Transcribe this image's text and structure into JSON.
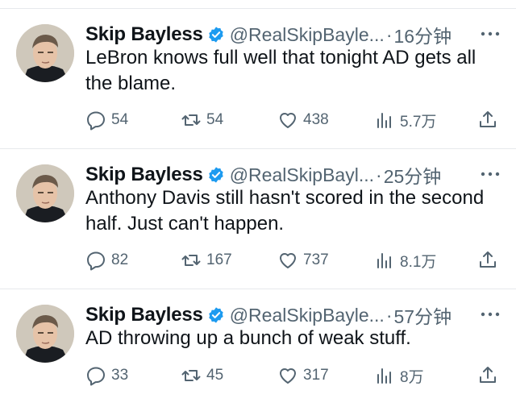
{
  "tweets": [
    {
      "name": "Skip Bayless",
      "handle": "@RealSkipBayle...",
      "dot": "·",
      "time": "16分钟",
      "text": "LeBron knows full well that tonight AD gets all the blame.",
      "replies": "54",
      "retweets": "54",
      "likes": "438",
      "views": "5.7万"
    },
    {
      "name": "Skip Bayless",
      "handle": "@RealSkipBayl...",
      "dot": "·",
      "time": "25分钟",
      "text": "Anthony Davis still hasn't scored in the second half. Just can't happen.",
      "replies": "82",
      "retweets": "167",
      "likes": "737",
      "views": "8.1万"
    },
    {
      "name": "Skip Bayless",
      "handle": "@RealSkipBayle...",
      "dot": "·",
      "time": "57分钟",
      "text": "AD throwing up a bunch of weak stuff.",
      "replies": "33",
      "retweets": "45",
      "likes": "317",
      "views": "8万"
    }
  ],
  "colors": {
    "verified": "#1d9bf0",
    "icon": "#536471",
    "text": "#0f1419",
    "divider": "#e6e9ec"
  },
  "icons": {
    "reply": "reply-icon",
    "retweet": "retweet-icon",
    "like": "heart-icon",
    "views": "views-icon",
    "share": "share-icon",
    "more": "more-icon",
    "verified": "verified-badge-icon"
  }
}
